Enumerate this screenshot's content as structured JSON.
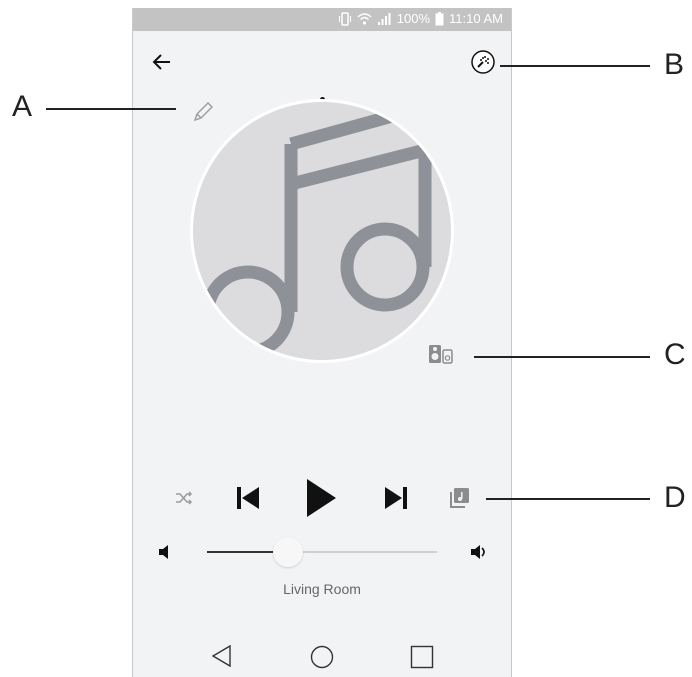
{
  "status_bar": {
    "battery": "100%",
    "time": "11:10 AM"
  },
  "player": {
    "room_name": "Living Room",
    "volume_percent": 35
  },
  "annotations": {
    "a": "A",
    "b": "B",
    "c": "C",
    "d": "D"
  },
  "colors": {
    "background": "#f2f3f5",
    "status_bar": "#c3c3c3",
    "album_bg": "#dcdcde",
    "note": "#8e9197",
    "icon_dark": "#111111",
    "icon_muted": "#9b9b9b"
  }
}
